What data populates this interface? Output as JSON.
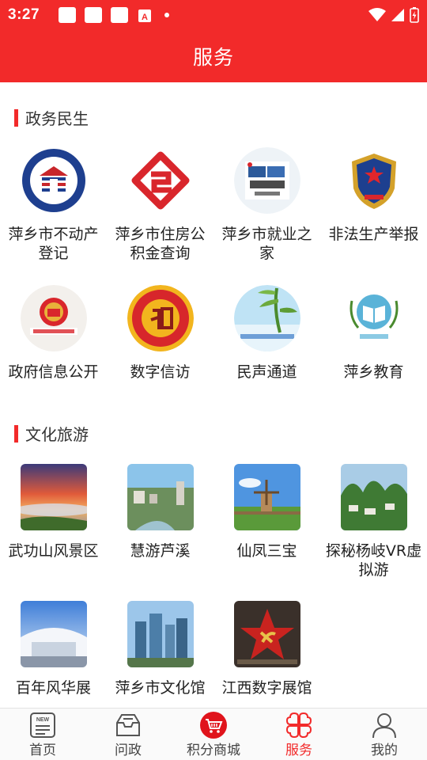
{
  "status_bar": {
    "time": "3:27"
  },
  "header": {
    "title": "服务"
  },
  "sections": [
    {
      "title": "政务民生",
      "items": [
        {
          "label": "萍乡市不动产登记",
          "icon": "real-estate-registration-seal-icon"
        },
        {
          "label": "萍乡市住房公积金查询",
          "icon": "housing-fund-logo-icon"
        },
        {
          "label": "萍乡市就业之家",
          "icon": "recruitment-poster-icon"
        },
        {
          "label": "非法生产举报",
          "icon": "emergency-management-emblem-icon"
        },
        {
          "label": "政府信息公开",
          "icon": "city-government-emblem-icon"
        },
        {
          "label": "数字信访",
          "icon": "petition-bureau-seal-icon"
        },
        {
          "label": "民声通道",
          "icon": "bamboo-voice-channel-icon"
        },
        {
          "label": "萍乡教育",
          "icon": "education-book-logo-icon"
        }
      ]
    },
    {
      "title": "文化旅游",
      "items": [
        {
          "label": "武功山风景区",
          "icon": "sunset-mountain-photo"
        },
        {
          "label": "慧游芦溪",
          "icon": "city-river-photo"
        },
        {
          "label": "仙凤三宝",
          "icon": "windmill-village-photo"
        },
        {
          "label": "探秘杨岐VR虚拟游",
          "icon": "karst-village-photo"
        },
        {
          "label": "百年风华展",
          "icon": "exhibition-hall-photo"
        },
        {
          "label": "萍乡市文化馆",
          "icon": "city-skyline-photo"
        },
        {
          "label": "江西数字展馆",
          "icon": "red-star-emblem-photo"
        }
      ]
    }
  ],
  "tabbar": [
    {
      "label": "首页",
      "icon": "newspaper-icon",
      "active": false
    },
    {
      "label": "问政",
      "icon": "mail-tray-icon",
      "active": false
    },
    {
      "label": "积分商城",
      "icon": "shopping-cart-icon",
      "active": false
    },
    {
      "label": "服务",
      "icon": "four-petal-grid-icon",
      "active": true
    },
    {
      "label": "我的",
      "icon": "user-profile-icon",
      "active": false
    }
  ],
  "colors": {
    "accent": "#f22a2a",
    "text": "#222222"
  }
}
